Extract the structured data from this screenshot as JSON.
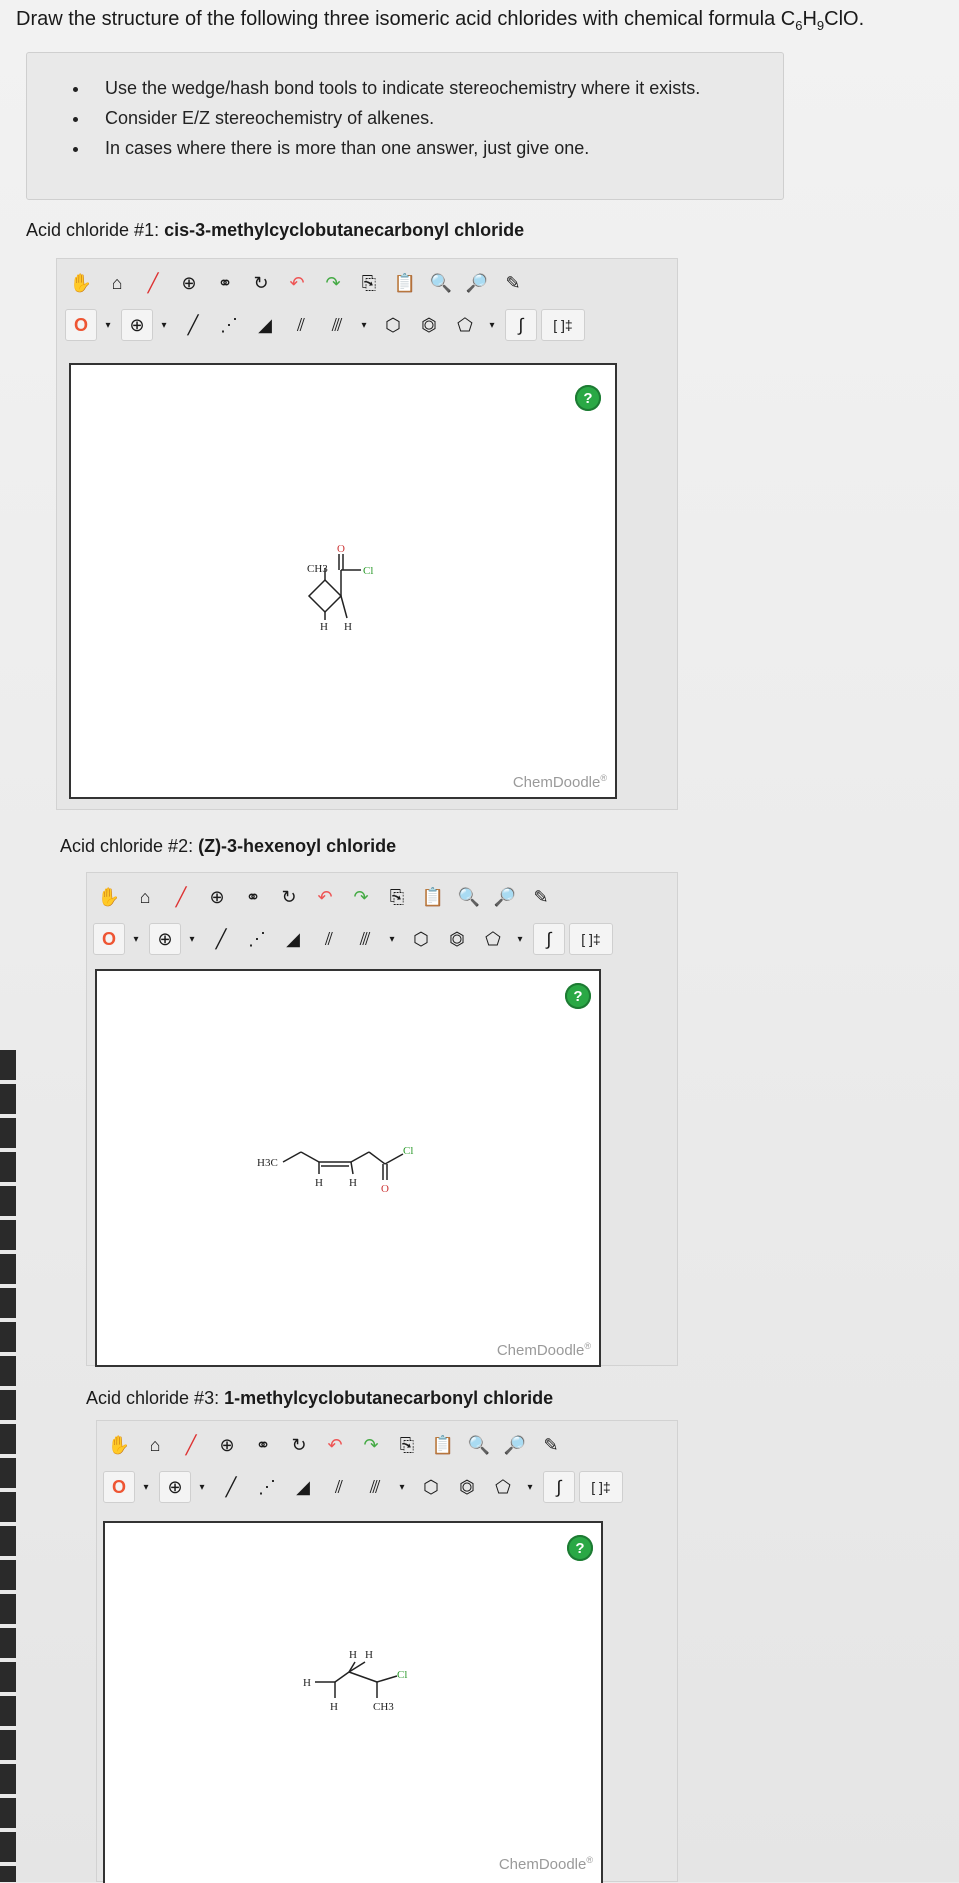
{
  "question": {
    "prefix": "Draw the structure of the following three isomeric acid chlorides with chemical formula C",
    "sub6": "6",
    "mid": "H",
    "sub9": "9",
    "suffix": "ClO."
  },
  "instructions": [
    "Use the wedge/hash bond tools to indicate stereochemistry where it exists.",
    "Consider E/Z stereochemistry of alkenes.",
    "In cases where there is more than one answer, just give one."
  ],
  "sections": [
    {
      "prefix": "Acid chloride #1: ",
      "name": "cis-3-methylcyclobutanecarbonyl chloride"
    },
    {
      "prefix": "Acid chloride #2: ",
      "name": "(Z)-3-hexenoyl chloride"
    },
    {
      "prefix": "Acid chloride #3: ",
      "name": "1-methylcyclobutanecarbonyl chloride"
    }
  ],
  "toolbar": {
    "element_label": "O",
    "charge_label": "⊕",
    "dropdown_glyph": "▾",
    "template_label": "[ ]‡",
    "help_label": "?",
    "icons": [
      "hand-icon",
      "lasso-icon",
      "eraser-icon",
      "center-icon",
      "flip-icon",
      "rotate-icon",
      "undo-icon",
      "redo-icon",
      "copy-icon",
      "paste-icon",
      "zoom-in-icon",
      "zoom-out-icon",
      "clean-icon"
    ]
  },
  "watermark": "ChemDoodle",
  "watermark_mark": "®",
  "structures": {
    "s1": {
      "ch3": "CH3",
      "o": "O",
      "cl": "Cl",
      "h1": "H",
      "h2": "H"
    },
    "s2": {
      "h3c": "H3C",
      "cl": "Cl",
      "h1": "H",
      "h2": "H",
      "o": "O"
    },
    "s3": {
      "h_top1": "H",
      "h_top2": "H",
      "h_left": "H",
      "h_bottom": "H",
      "ch3": "CH3",
      "cl": "Cl"
    }
  }
}
